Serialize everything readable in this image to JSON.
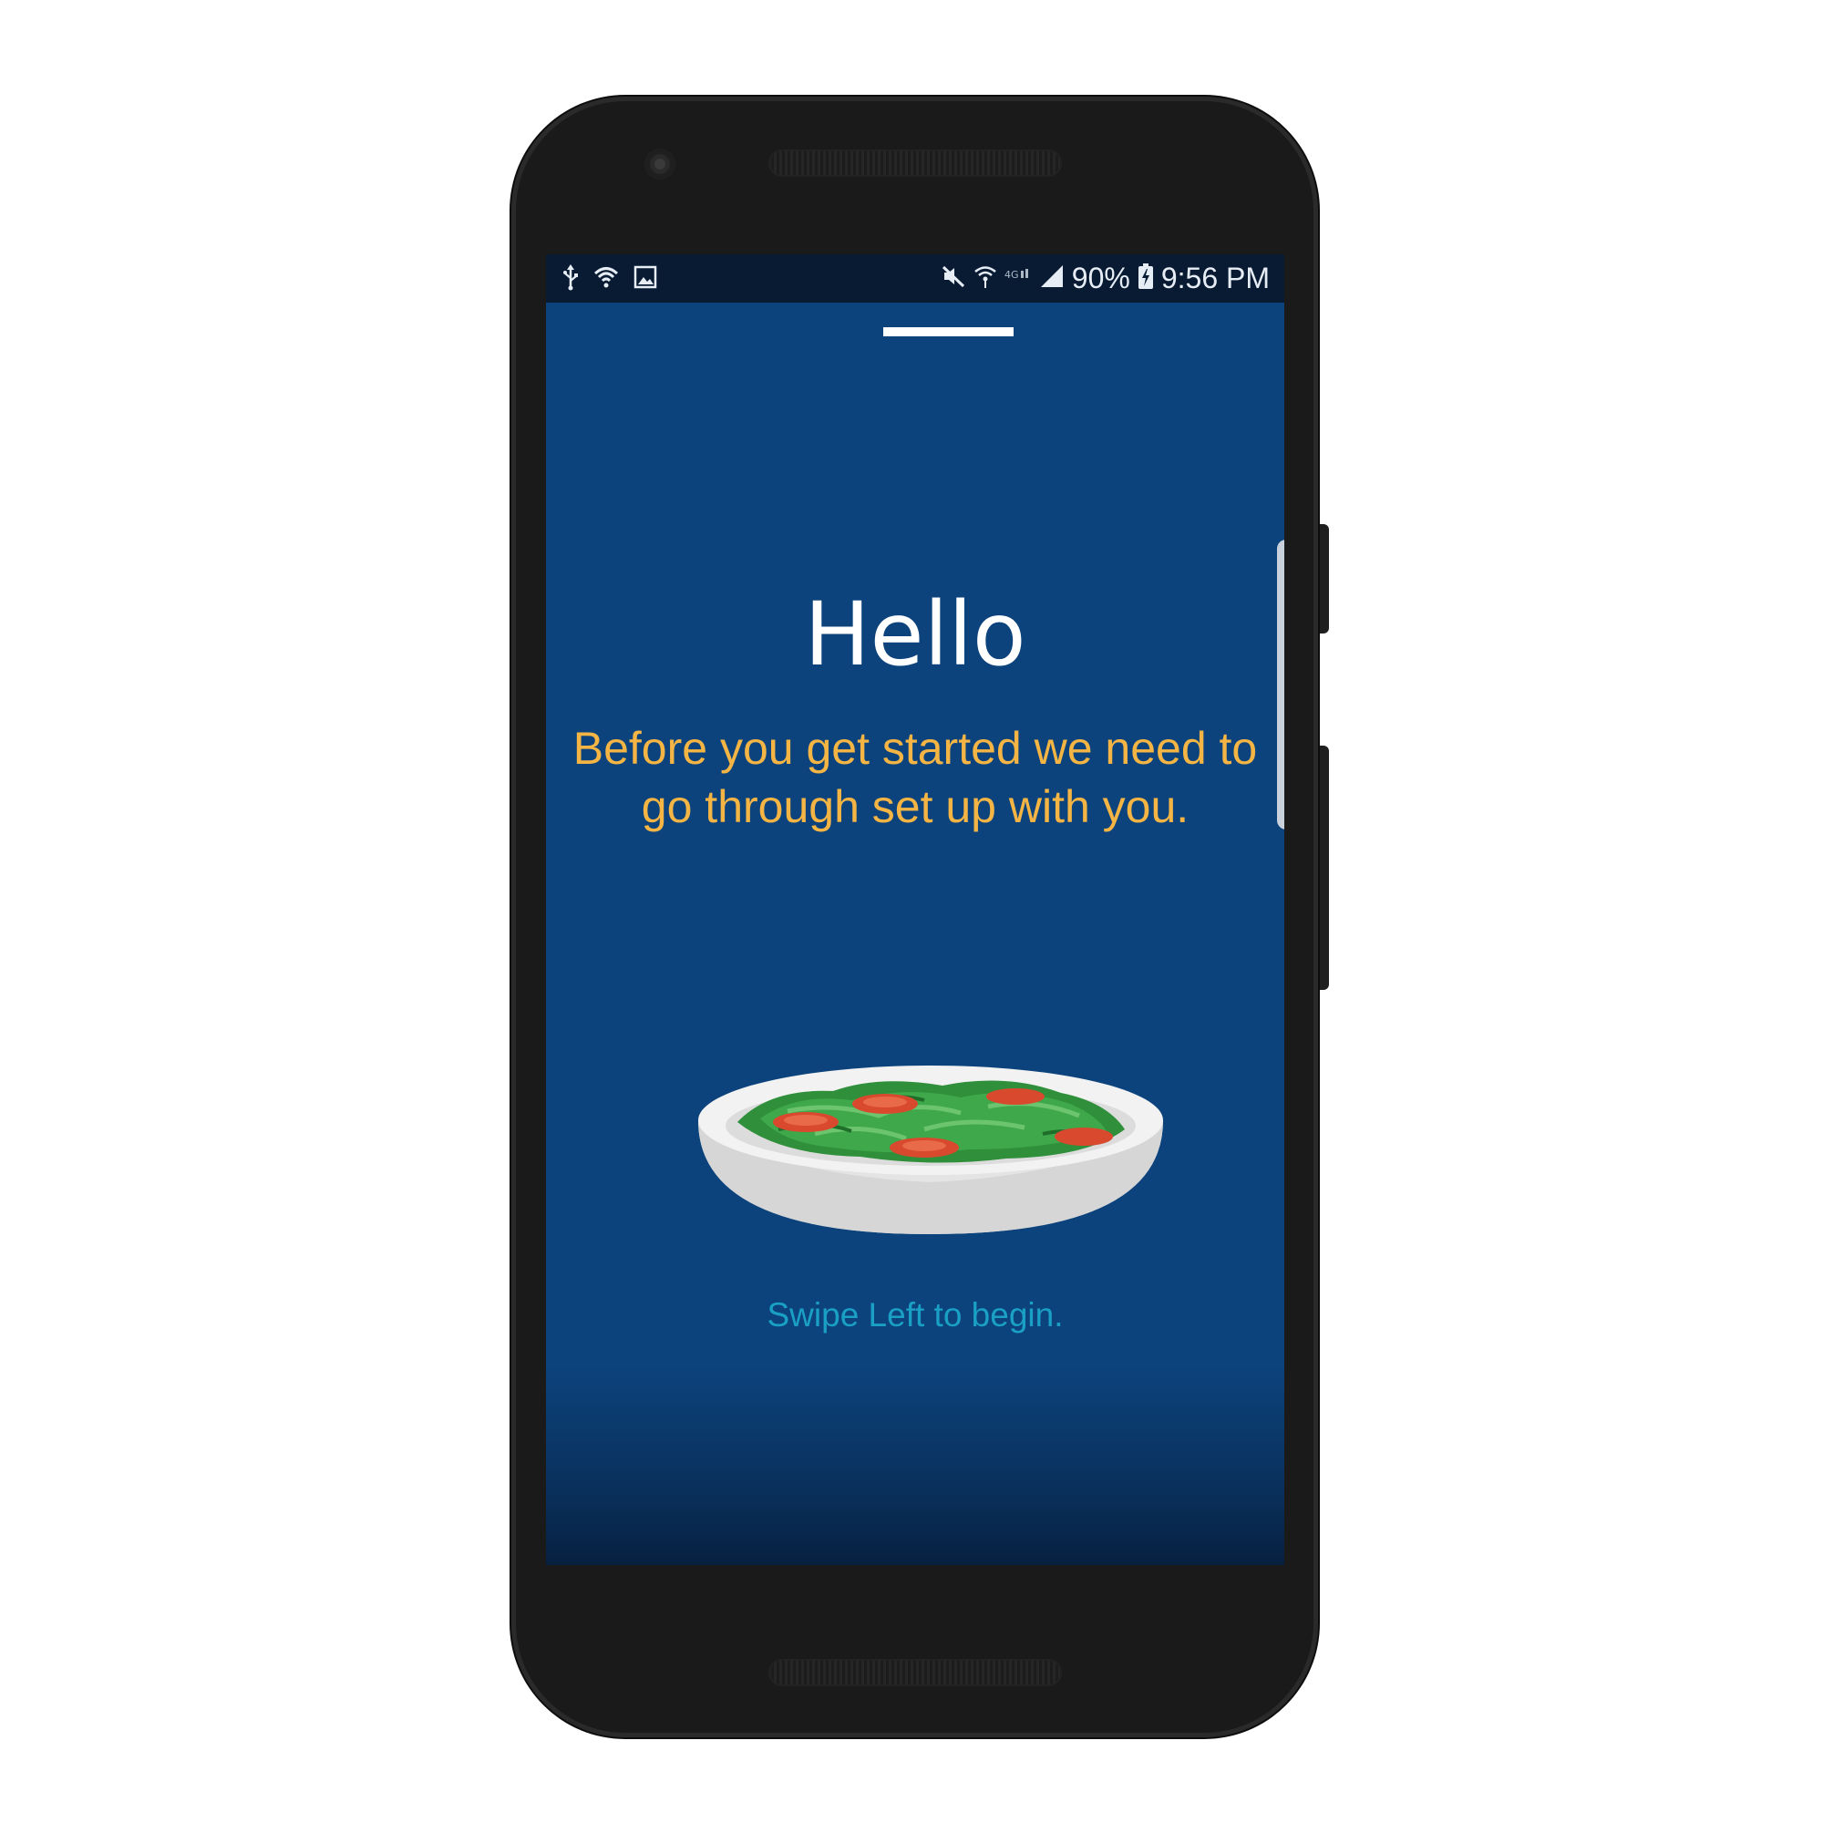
{
  "status_bar": {
    "battery": "90%",
    "time": "9:56 PM",
    "left_icons": [
      "usb-icon",
      "wifi-icon",
      "image-icon"
    ],
    "right_icons": [
      "mute-icon",
      "wifi-calling-icon",
      "lte-icon",
      "signal-icon",
      "battery-charging-icon"
    ]
  },
  "onboarding": {
    "title": "Hello",
    "subtitle": "Before you get started we need to go through set up with you.",
    "hint": "Swipe Left to begin.",
    "illustration": "salad-bowl-icon"
  },
  "colors": {
    "screen_background": "#0c437c",
    "status_bar_background": "#081b33",
    "title": "#ffffff",
    "subtitle": "#f5b544",
    "hint": "#1aa0c4",
    "device_body": "#1a1a1a"
  }
}
